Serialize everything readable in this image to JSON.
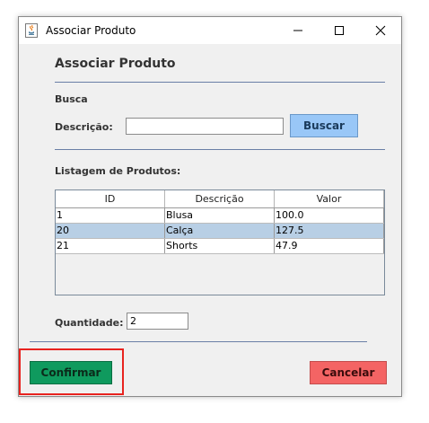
{
  "window": {
    "title": "Associar Produto"
  },
  "form": {
    "heading": "Associar Produto",
    "search_section": "Busca",
    "description_label": "Descrição:",
    "description_value": "",
    "search_button": "Buscar",
    "list_label": "Listagem de Produtos:",
    "quantity_label": "Quantidade:",
    "quantity_value": "2",
    "confirm_button": "Confirmar",
    "cancel_button": "Cancelar"
  },
  "table": {
    "columns": [
      "ID",
      "Descrição",
      "Valor"
    ],
    "rows": [
      [
        "1",
        "Blusa",
        "100.0"
      ],
      [
        "20",
        "Calça",
        "127.5"
      ],
      [
        "21",
        "Shorts",
        "47.9"
      ]
    ],
    "selected_row_index": 1
  },
  "icons": {
    "app": "java-coffee-icon",
    "minimize": "minimize-icon",
    "maximize": "maximize-icon",
    "close": "close-icon"
  },
  "colors": {
    "search_button": "#99c7f7",
    "confirm_button": "#0f9a5e",
    "cancel_button": "#f46464",
    "selected_row": "#b8cfe5",
    "highlight_box": "#e8231f"
  }
}
